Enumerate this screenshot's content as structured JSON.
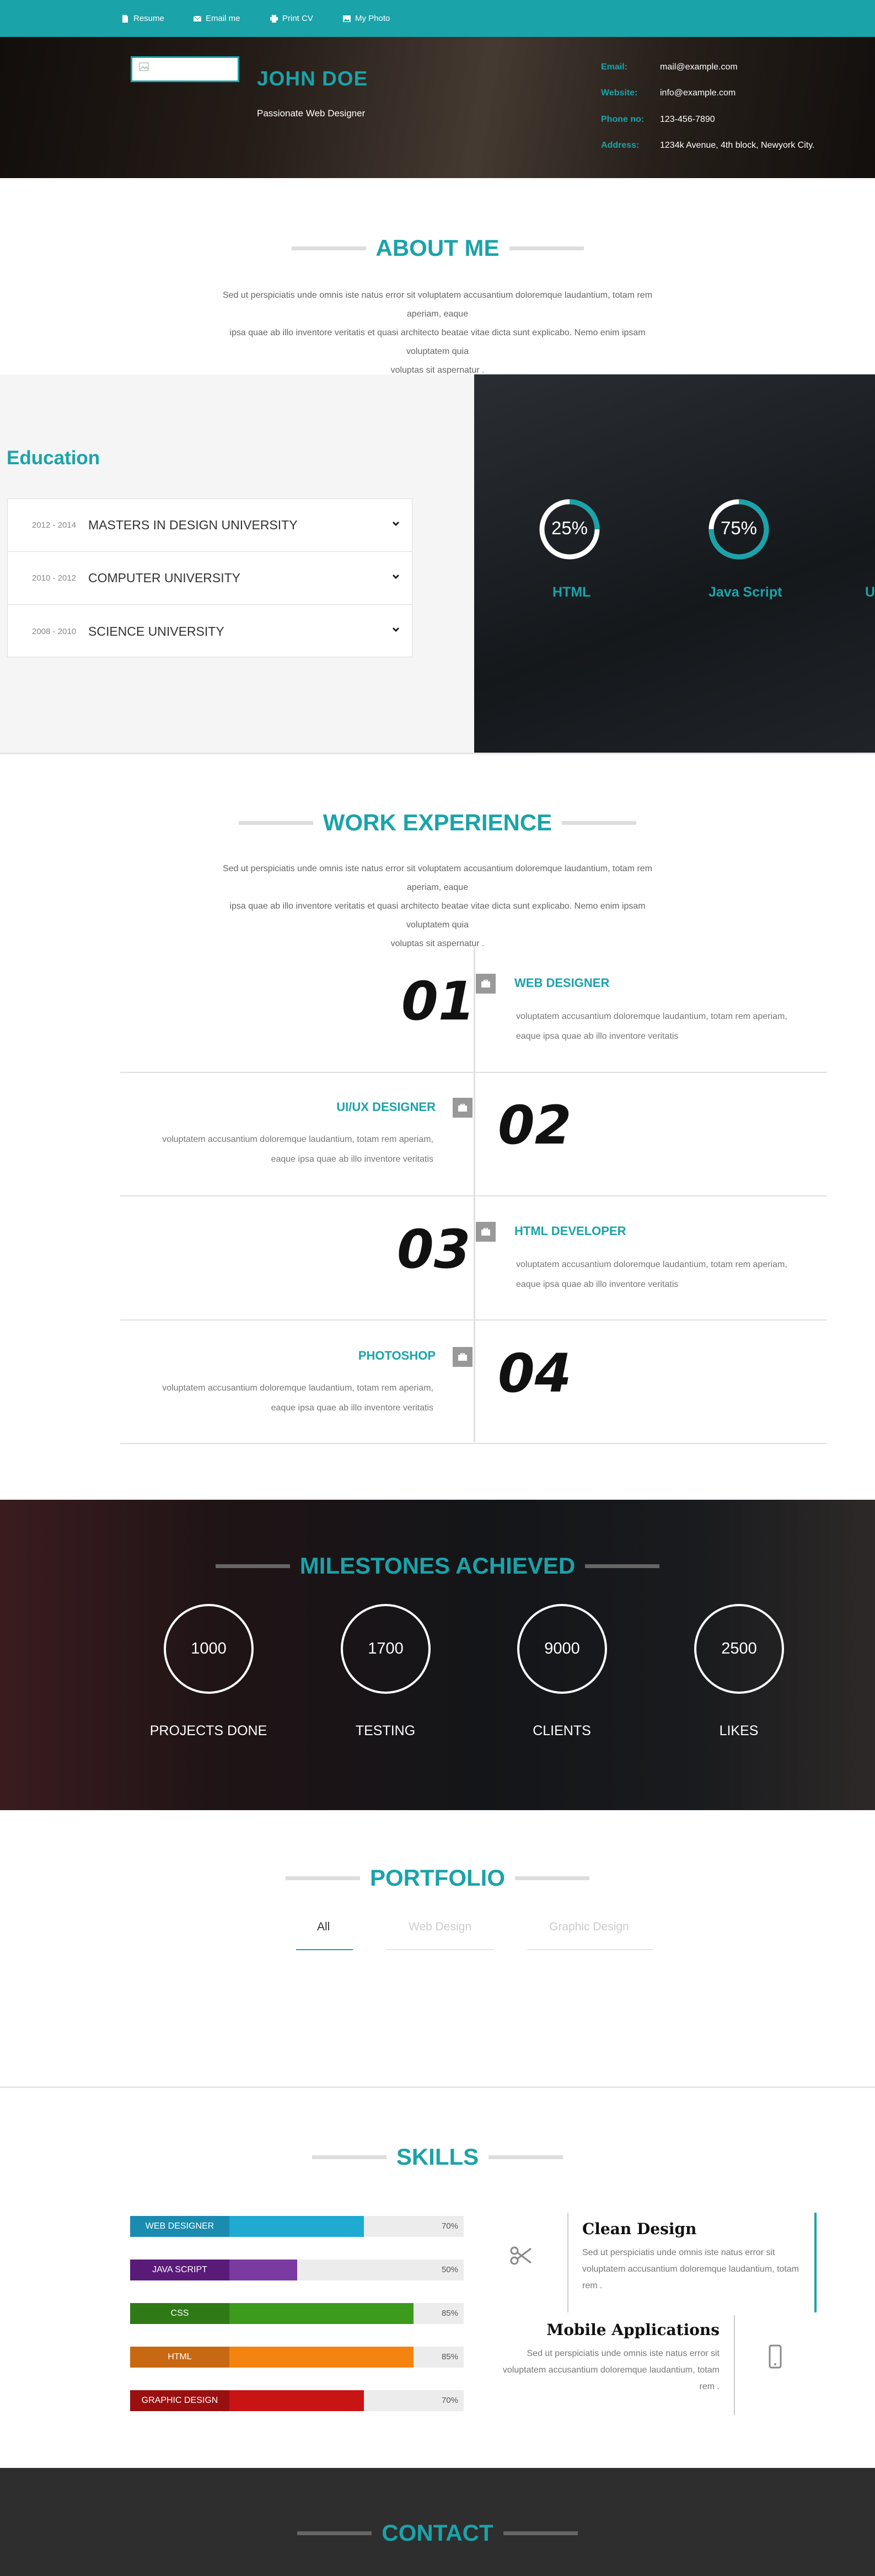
{
  "nav": [
    {
      "label": "Resume",
      "icon": "file-icon"
    },
    {
      "label": "Email me",
      "icon": "envelope-icon"
    },
    {
      "label": "Print CV",
      "icon": "print-icon"
    },
    {
      "label": "My Photo",
      "icon": "image-icon"
    }
  ],
  "header": {
    "name": "JOHN DOE",
    "tagline": "Passionate Web Designer",
    "contacts": [
      {
        "key": "Email:",
        "value": "mail@example.com"
      },
      {
        "key": "Website:",
        "value": "info@example.com"
      },
      {
        "key": "Phone no:",
        "value": "123-456-7890"
      },
      {
        "key": "Address:",
        "value": "1234k Avenue, 4th block, Newyork City."
      }
    ]
  },
  "about": {
    "title": "ABOUT ME",
    "lines": [
      "Sed ut perspiciatis unde omnis iste natus error sit voluptatem accusantium doloremque laudantium, totam rem aperiam, eaque",
      "ipsa quae ab illo inventore veritatis et quasi architecto beatae vitae dicta sunt explicabo. Nemo enim ipsam voluptatem quia",
      "voluptas sit aspernatur ."
    ]
  },
  "education": {
    "title": "Education",
    "items": [
      {
        "years": "2012 - 2014",
        "name": "MASTERS IN DESIGN UNIVERSITY"
      },
      {
        "years": "2010 - 2012",
        "name": "COMPUTER UNIVERSITY"
      },
      {
        "years": "2008 - 2010",
        "name": "SCIENCE UNIVERSITY"
      }
    ]
  },
  "skill_rings": [
    {
      "label": "HTML",
      "value": "25%",
      "fraction": 0.25
    },
    {
      "label": "Java Script",
      "value": "75%",
      "fraction": 0.75
    },
    {
      "label": "U",
      "value": "",
      "fraction": 0
    }
  ],
  "work": {
    "title": "WORK EXPERIENCE",
    "lines": [
      "Sed ut perspiciatis unde omnis iste natus error sit voluptatem accusantium doloremque laudantium, totam rem aperiam, eaque",
      "ipsa quae ab illo inventore veritatis et quasi architecto beatae vitae dicta sunt explicabo. Nemo enim ipsam voluptatem quia",
      "voluptas sit aspernatur ."
    ],
    "items": [
      {
        "num": "01",
        "title": "WEB DESIGNER",
        "text1": "voluptatem accusantium doloremque laudantium, totam rem aperiam,",
        "text2": "eaque ipsa quae ab illo inventore veritatis"
      },
      {
        "num": "02",
        "title": "UI/UX DESIGNER",
        "text1": "voluptatem accusantium doloremque laudantium, totam rem aperiam,",
        "text2": "eaque ipsa quae ab illo inventore veritatis"
      },
      {
        "num": "03",
        "title": "HTML DEVELOPER",
        "text1": "voluptatem accusantium doloremque laudantium, totam rem aperiam,",
        "text2": "eaque ipsa quae ab illo inventore veritatis"
      },
      {
        "num": "04",
        "title": "PHOTOSHOP",
        "text1": "voluptatem accusantium doloremque laudantium, totam rem aperiam,",
        "text2": "eaque ipsa quae ab illo inventore veritatis"
      }
    ]
  },
  "milestones": {
    "title": "MILESTONES ACHIEVED",
    "items": [
      {
        "value": "1000",
        "label": "PROJECTS DONE"
      },
      {
        "value": "1700",
        "label": "TESTING"
      },
      {
        "value": "9000",
        "label": "CLIENTS"
      },
      {
        "value": "2500",
        "label": "LIKES"
      }
    ]
  },
  "portfolio": {
    "title": "PORTFOLIO",
    "tabs": [
      "All",
      "Web Design",
      "Graphic Design"
    ]
  },
  "skills": {
    "title": "SKILLS",
    "bars": [
      {
        "label": "WEB DESIGNER",
        "percent": "70%",
        "fraction": 0.7,
        "dark": "#1a8cb0",
        "light": "#1fabd1"
      },
      {
        "label": "JAVA SCRIPT",
        "percent": "50%",
        "fraction": 0.5,
        "dark": "#5a1a78",
        "light": "#7a3aa0"
      },
      {
        "label": "CSS",
        "percent": "85%",
        "fraction": 0.85,
        "dark": "#2f7a16",
        "light": "#3c9a1c"
      },
      {
        "label": "HTML",
        "percent": "85%",
        "fraction": 0.85,
        "dark": "#c86812",
        "light": "#f58310"
      },
      {
        "label": "GRAPHIC DESIGN",
        "percent": "70%",
        "fraction": 0.7,
        "dark": "#9a1010",
        "light": "#c81414"
      }
    ],
    "features": [
      {
        "title": "Clean Design",
        "icon": "scissors-icon",
        "lines": [
          "Sed ut perspiciatis unde omnis iste natus error sit",
          "voluptatem accusantium doloremque laudantium, totam",
          "rem ."
        ]
      },
      {
        "title": "Mobile Applications",
        "icon": "mobile-icon",
        "lines": [
          "Sed ut perspiciatis unde omnis iste natus error sit",
          "voluptatem accusantium doloremque laudantium, totam",
          "rem ."
        ]
      }
    ]
  },
  "contact": {
    "title": "CONTACT"
  },
  "colors": {
    "accent": "#1aa3a9"
  }
}
